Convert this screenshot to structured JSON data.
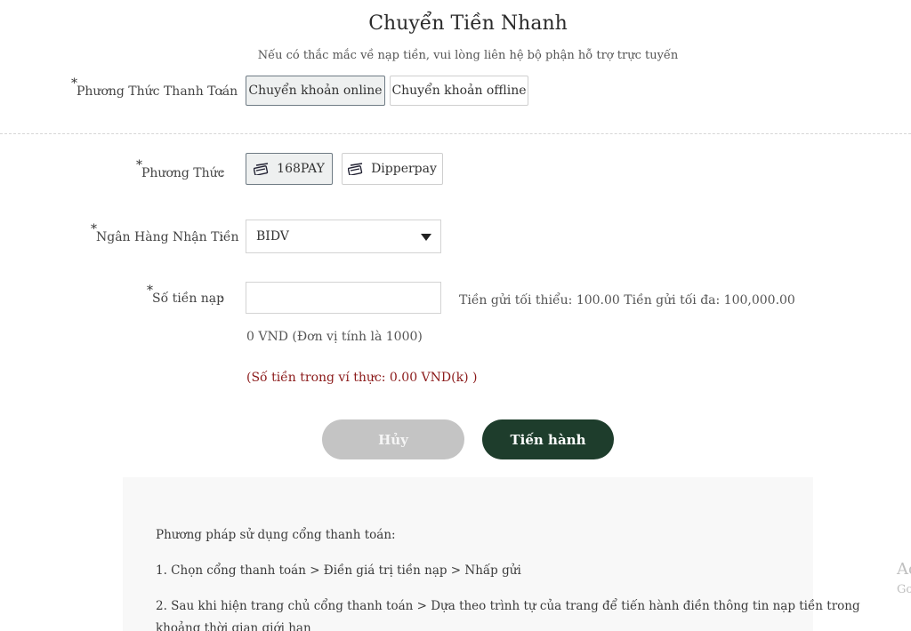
{
  "header": {
    "title": "Chuyển Tiền Nhanh",
    "subtitle": "Nếu có thắc mắc về nạp tiền, vui lòng liên hệ bộ phận hỗ trợ trực tuyến"
  },
  "payment_type": {
    "required_mark": "*",
    "label": "Phương Thức Thanh Toán",
    "colon": ":",
    "options": [
      "Chuyển khoản online",
      "Chuyển khoản offline"
    ],
    "selected": "Chuyển khoản online"
  },
  "method": {
    "required_mark": "*",
    "label": "Phương Thức",
    "colon": ":",
    "options": [
      "168PAY",
      "Dipperpay"
    ],
    "selected": "168PAY",
    "icon": "card-icon"
  },
  "bank": {
    "required_mark": "*",
    "label": "Ngân Hàng Nhận Tiền",
    "colon": ":",
    "selected": "BIDV"
  },
  "amount": {
    "required_mark": "*",
    "label": "Số tiền nạp",
    "colon": ":",
    "value": "",
    "limits": "Tiền gửi tối thiểu: 100.00 Tiền gửi tối đa: 100,000.00",
    "converted": "0 VND (Đơn vị tính là 1000)",
    "wallet": "(Số tiền trong ví thực: 0.00 VND(k) )"
  },
  "actions": {
    "cancel_label": "Hủy",
    "proceed_label": "Tiến hành"
  },
  "instructions": {
    "heading": "Phương pháp sử dụng cổng thanh toán:",
    "step1": "1. Chọn cổng thanh toán > Điền giá trị tiền nạp > Nhấp gửi",
    "step2_line1": "2. Sau khi hiện trang chủ cổng thanh toán > Dựa theo trình tự của trang để tiến hành điền thông tin nạp tiền trong",
    "step2_line2": "khoảng thời gian giới hạn"
  },
  "watermark": {
    "line1": "Ac",
    "line2": "Go"
  },
  "colors": {
    "primary": "#1e3d2c",
    "cancel": "#c4c4c4",
    "error": "#8b1a1a"
  }
}
